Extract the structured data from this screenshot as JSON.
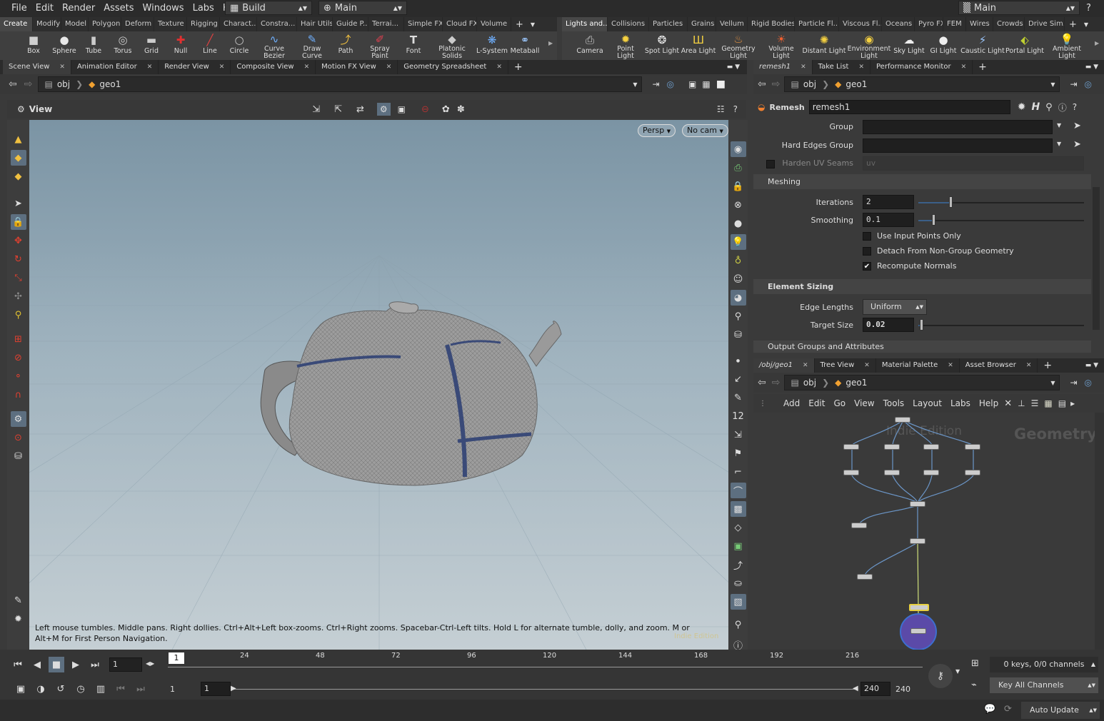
{
  "menu": {
    "items": [
      "File",
      "Edit",
      "Render",
      "Assets",
      "Windows",
      "Labs",
      "Help"
    ],
    "desktop": "Build",
    "desktop2": "Main",
    "right_desktop": "Main"
  },
  "shelf_left": {
    "tabs": [
      "Create",
      "Modify",
      "Model",
      "Polygon",
      "Deform",
      "Texture",
      "Rigging",
      "Charact...",
      "Constra...",
      "Hair Utils",
      "Guide P...",
      "Terrai...",
      "Simple FX",
      "Cloud FX",
      "Volume"
    ],
    "tools": [
      "Box",
      "Sphere",
      "Tube",
      "Torus",
      "Grid",
      "Null",
      "Line",
      "Circle",
      "Curve Bezier",
      "Draw Curve",
      "Path",
      "Spray Paint",
      "Font",
      "Platonic Solids",
      "L-System",
      "Metaball"
    ]
  },
  "shelf_right": {
    "tabs": [
      "Lights and...",
      "Collisions",
      "Particles",
      "Grains",
      "Vellum",
      "Rigid Bodies",
      "Particle Fl...",
      "Viscous Fl...",
      "Oceans",
      "Pyro FX",
      "FEM",
      "Wires",
      "Crowds",
      "Drive Sim..."
    ],
    "tools": [
      "Camera",
      "Point Light",
      "Spot Light",
      "Area Light",
      "Geometry Light",
      "Volume Light",
      "Distant Light",
      "Environment Light",
      "Sky Light",
      "GI Light",
      "Caustic Light",
      "Portal Light",
      "Ambient Light"
    ]
  },
  "left_pane": {
    "tabs": [
      "Scene View",
      "Animation Editor",
      "Render View",
      "Composite View",
      "Motion FX View",
      "Geometry Spreadsheet"
    ],
    "path": [
      "obj",
      "geo1"
    ],
    "view_label": "View",
    "persp": "Persp",
    "cam": "No cam",
    "help_text": "Left mouse tumbles. Middle pans. Right dollies. Ctrl+Alt+Left box-zooms. Ctrl+Right zooms. Spacebar-Ctrl-Left tilts. Hold L for alternate tumble, dolly, and zoom.     M or Alt+M for First Person Navigation.",
    "watermark": "Indie Edition"
  },
  "params": {
    "tabs": [
      "remesh1",
      "Take List",
      "Performance Monitor"
    ],
    "path": [
      "obj",
      "geo1"
    ],
    "node_type": "Remesh",
    "node_name": "remesh1",
    "group_label": "Group",
    "hard_edges_label": "Hard Edges Group",
    "harden_uv_label": "Harden UV Seams",
    "harden_uv_value": "uv",
    "meshing_section": "Meshing",
    "iterations_label": "Iterations",
    "iterations_value": "2",
    "iterations_fraction": 0.2,
    "smoothing_label": "Smoothing",
    "smoothing_value": "0.1",
    "smoothing_fraction": 0.1,
    "use_input_points": "Use Input Points Only",
    "use_input_points_checked": false,
    "detach": "Detach From Non-Group Geometry",
    "detach_checked": false,
    "recompute": "Recompute Normals",
    "recompute_checked": true,
    "element_sizing": "Element Sizing",
    "edge_lengths_label": "Edge Lengths",
    "edge_lengths_value": "Uniform",
    "target_size_label": "Target Size",
    "target_size_value": "0.02",
    "target_size_fraction": 0.02,
    "output_section": "Output Groups and Attributes"
  },
  "network": {
    "tabs": [
      "/obj/geo1",
      "Tree View",
      "Material Palette",
      "Asset Browser"
    ],
    "path": [
      "obj",
      "geo1"
    ],
    "menu": [
      "Add",
      "Edit",
      "Go",
      "View",
      "Tools",
      "Layout",
      "Labs",
      "Help"
    ],
    "watermark": "Indie Edition",
    "context": "Geometry"
  },
  "timeline": {
    "frame": "1",
    "ticks": [
      "24",
      "48",
      "72",
      "96",
      "120",
      "144",
      "168",
      "192",
      "216"
    ],
    "start": "1",
    "start2": "1",
    "end": "240",
    "end2": "240",
    "cursor_frame": "1",
    "keys": "0 keys, 0/0 channels",
    "key_all": "Key All Channels",
    "update": "Auto Update"
  }
}
